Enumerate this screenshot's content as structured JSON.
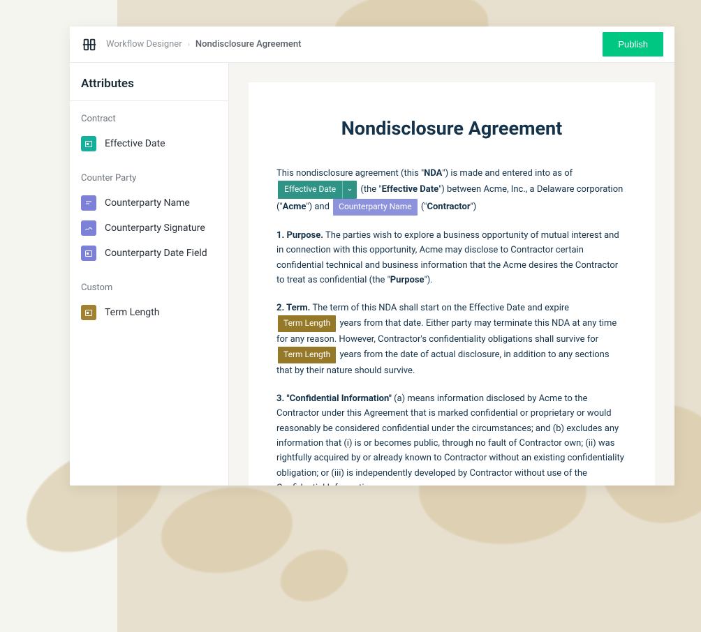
{
  "breadcrumb": {
    "parent": "Workflow Designer",
    "current": "Nondisclosure Agreement"
  },
  "actions": {
    "publish": "Publish"
  },
  "sidebar": {
    "title": "Attributes",
    "groups": {
      "contract": {
        "label": "Contract",
        "effective_date": "Effective Date"
      },
      "counterparty": {
        "label": "Counter Party",
        "name": "Counterparty Name",
        "signature": "Counterparty Signature",
        "date_field": "Counterparty Date Field"
      },
      "custom": {
        "label": "Custom",
        "term_length": "Term Length"
      }
    }
  },
  "document": {
    "title": "Nondisclosure Agreement",
    "intro": {
      "t1": "This nondisclosure agreement (this \"",
      "nda": "NDA",
      "t2": "\") is made and entered into as of ",
      "token_effective": "Effective Date",
      "t3": " (the \"",
      "effective_b": "Effective Date",
      "t4": "\") between Acme, Inc., a Delaware corporation (\"",
      "acme": "Acme",
      "t5": "\") and ",
      "token_cp": "Counterparty Name",
      "t6": " (\"",
      "contractor_b": "Contractor",
      "t7": "\")"
    },
    "purpose": {
      "num": "1. Purpose.",
      "text": "  The parties wish to explore a business opportunity of mutual interest and in connection with this opportunity, Acme may disclose to Contractor certain confidential technical and business information that the Acme desires the Contractor to treat as confidential (the \"",
      "b": "Purpose",
      "tail": "\")."
    },
    "term": {
      "num": "2.  Term.",
      "t1": "  The term of this NDA shall start on the Effective Date and expire ",
      "token": "Term Length",
      "t2": " years from that date. Either party may terminate this NDA at any time for any reason. However, Contractor's confidentiality obligations shall survive for ",
      "t3": " years from the date of actual disclosure, in addition to any sections that by their nature should survive."
    },
    "ci": {
      "num": "3. \"Confidential Information\"",
      "text": " (a) means information disclosed by Acme to the Contractor under this Agreement that is marked confidential or proprietary or would reasonably be considered confidential under the circumstances; and (b) excludes any information that (i) is or becomes public, through no fault of Contractor own; (ii) was rightfully acquired by or already known to Contractor without an existing confidentiality obligation; or (iii) is independently developed by Contractor without use of the Confidential Information."
    }
  }
}
